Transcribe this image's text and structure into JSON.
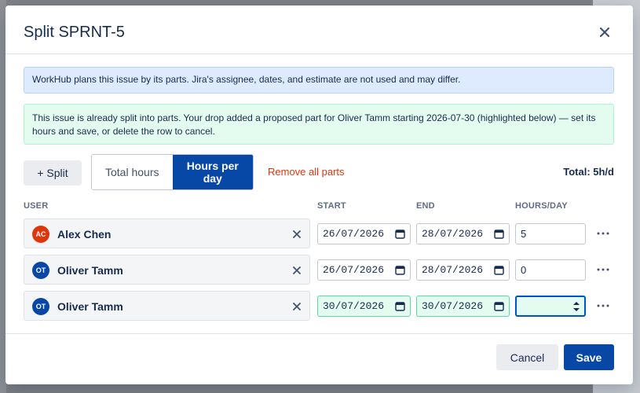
{
  "dialog": {
    "title": "Split SPRNT-5"
  },
  "banners": {
    "info": "WorkHub plans this issue by its parts. Jira's assignee, dates, and estimate are not used and may differ.",
    "success": "This issue is already split into parts. Your drop added a proposed part for Oliver Tamm starting 2026-07-30 (highlighted below) — set its hours and save, or delete the row to cancel."
  },
  "toolbar": {
    "split_label": "+ Split",
    "mode_total": "Total hours",
    "mode_day": "Hours per day",
    "active_mode": "Hours per day",
    "remove_all": "Remove all parts",
    "total": "Total: 5h/d"
  },
  "columns": {
    "user": "USER",
    "start": "START",
    "end": "END",
    "hours": "HOURS/DAY"
  },
  "parts": [
    {
      "initials": "AC",
      "name": "Alex Chen",
      "avatar_color": "#de350b",
      "start": "26/07/2026",
      "end": "28/07/2026",
      "hours": "5",
      "highlighted": false
    },
    {
      "initials": "OT",
      "name": "Oliver Tamm",
      "avatar_color": "#0747a6",
      "start": "26/07/2026",
      "end": "28/07/2026",
      "hours": "0",
      "highlighted": false
    },
    {
      "initials": "OT",
      "name": "Oliver Tamm",
      "avatar_color": "#0747a6",
      "start": "30/07/2026",
      "end": "30/07/2026",
      "hours": "",
      "highlighted": true
    }
  ],
  "footer": {
    "cancel": "Cancel",
    "save": "Save"
  },
  "colors": {
    "primary": "#0747a6",
    "danger": "#de350b",
    "highlight": "#e3fcef"
  },
  "icons": {
    "close": "close-icon",
    "clear": "clear-icon",
    "calendar": "calendar-icon",
    "more": "more-icon"
  }
}
